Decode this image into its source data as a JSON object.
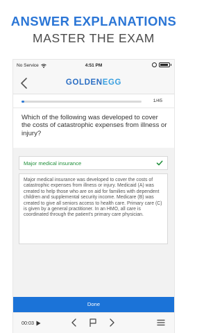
{
  "promo": {
    "title": "ANSWER EXPLANATIONS",
    "subtitle": "MASTER THE EXAM"
  },
  "status_bar": {
    "carrier": "No Service",
    "time": "4:51 PM",
    "icons": [
      "wifi-icon",
      "rotation-lock-icon",
      "battery-icon"
    ]
  },
  "nav": {
    "back_icon": "chevron-left-icon",
    "logo_part1": "GOLDEN",
    "logo_part2": "EGG"
  },
  "progress": {
    "label": "1/45",
    "fraction": 0.022
  },
  "question": {
    "text": "Which of the following was developed to cover the costs of catastrophic expenses from illness or injury?"
  },
  "answer": {
    "text": "Major medical insurance",
    "status_icon": "checkmark-icon",
    "correct_color": "#1f8f3a"
  },
  "explanation": {
    "text": "Major medical insurance was developed to cover the costs of catastrophic expenses from illness or injury. Medicaid (A) was created to help those who are on aid for families with dependent children and supplemental security income. Medicare (B) was created to give all seniors access to health care. Primary care (C) is given by a general practitioner. In an HMO, all care is coordinated through the patient's primary care physician."
  },
  "done_button": {
    "label": "Done",
    "color": "#1b73d8"
  },
  "toolbar": {
    "timer": "00:03",
    "icons": [
      "play-icon",
      "chevron-left-icon",
      "flag-icon",
      "chevron-right-icon",
      "menu-icon"
    ]
  },
  "colors": {
    "promo_title": "#2b76d6",
    "accent": "#2f7bd6"
  }
}
